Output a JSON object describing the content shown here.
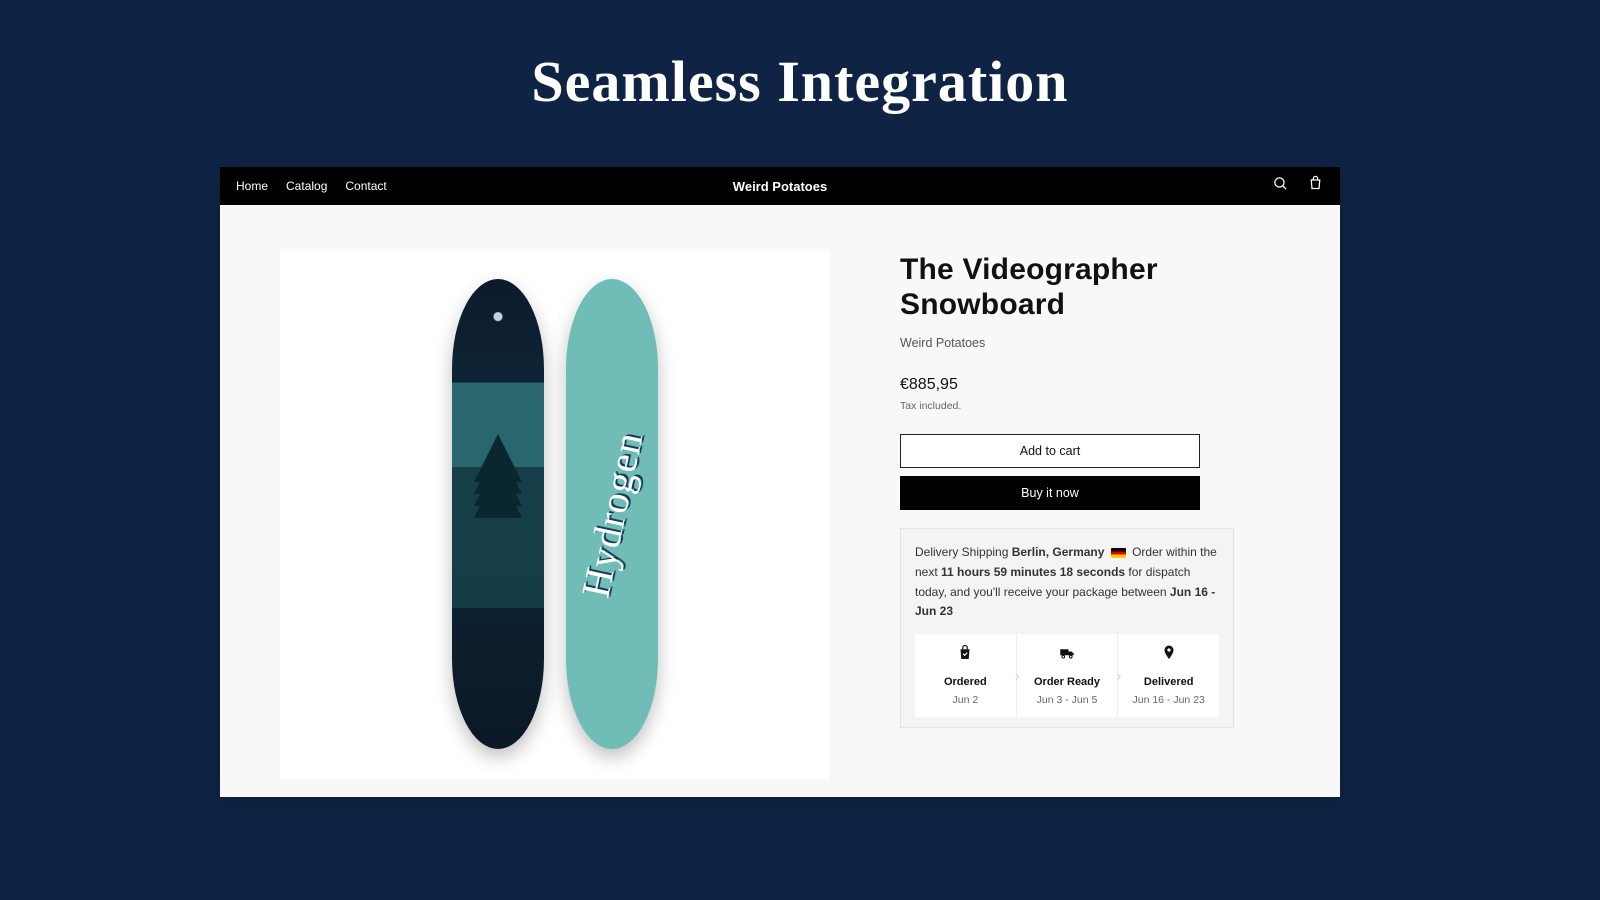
{
  "headline": "Seamless Integration",
  "nav": {
    "items": [
      "Home",
      "Catalog",
      "Contact"
    ],
    "brand": "Weird Potatoes"
  },
  "product": {
    "title": "The Videographer Snowboard",
    "vendor": "Weird Potatoes",
    "price": "€885,95",
    "tax_note": "Tax included.",
    "add_to_cart": "Add to cart",
    "buy_now": "Buy it now",
    "back_text": "Hydrogen"
  },
  "shipping": {
    "prefix": "Delivery Shipping ",
    "location": "Berlin, Germany",
    "mid1": " Order within the next ",
    "countdown": "11 hours 59 minutes 18 seconds",
    "mid2": " for dispatch today, and you'll receive your package between ",
    "range": "Jun 16 - Jun 23"
  },
  "steps": [
    {
      "label": "Ordered",
      "date": "Jun 2"
    },
    {
      "label": "Order Ready",
      "date": "Jun 3 - Jun 5"
    },
    {
      "label": "Delivered",
      "date": "Jun 16 - Jun 23"
    }
  ]
}
